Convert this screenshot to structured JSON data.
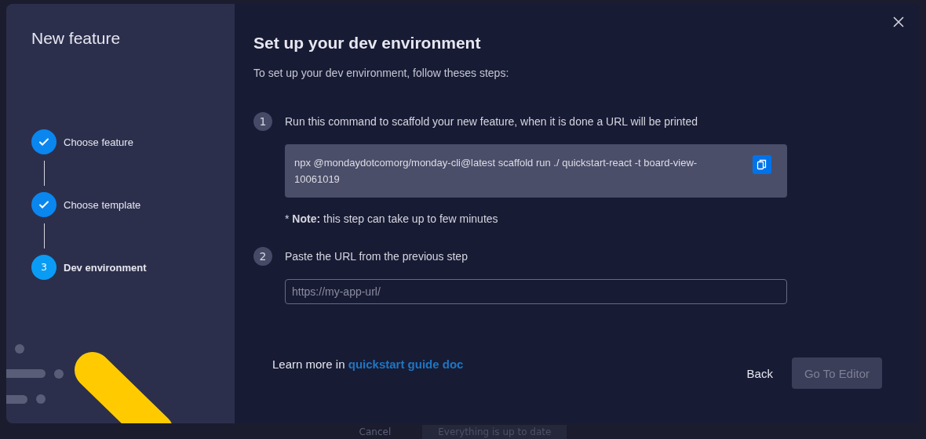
{
  "backdrop": {
    "cancel_label": "Cancel",
    "status_button": "Everything is up to date"
  },
  "sidebar": {
    "title": "New feature",
    "steps": [
      {
        "label": "Choose feature",
        "completed": true,
        "selected": false
      },
      {
        "label": "Choose template",
        "completed": true,
        "selected": false
      },
      {
        "label": "Dev environment",
        "number": "3",
        "completed": false,
        "selected": true
      }
    ]
  },
  "main": {
    "title": "Set up your dev environment",
    "subtitle": "To set up your dev environment, follow theses steps:",
    "instructions": [
      {
        "kind": "command",
        "number": "1",
        "text": "Run this command to scaffold your new feature, when it is done a URL will be printed",
        "command": "npx @mondaydotcomorg/monday-cli@latest scaffold run ./ quickstart-react -t board-view-10061019",
        "note": "* **Note:** this step can take up to few minutes"
      },
      {
        "kind": "input",
        "number": "2",
        "text": "Paste the URL from the previous step",
        "placeholder": "https://my-app-url/"
      }
    ],
    "learn_more": {
      "text": "Learn more in",
      "link": "quickstart guide doc"
    },
    "buttons": [
      {
        "label": "Back",
        "kind": "tertiary",
        "disabled": false
      },
      {
        "label": "Go To Editor",
        "kind": "primary",
        "disabled": true
      }
    ]
  }
}
